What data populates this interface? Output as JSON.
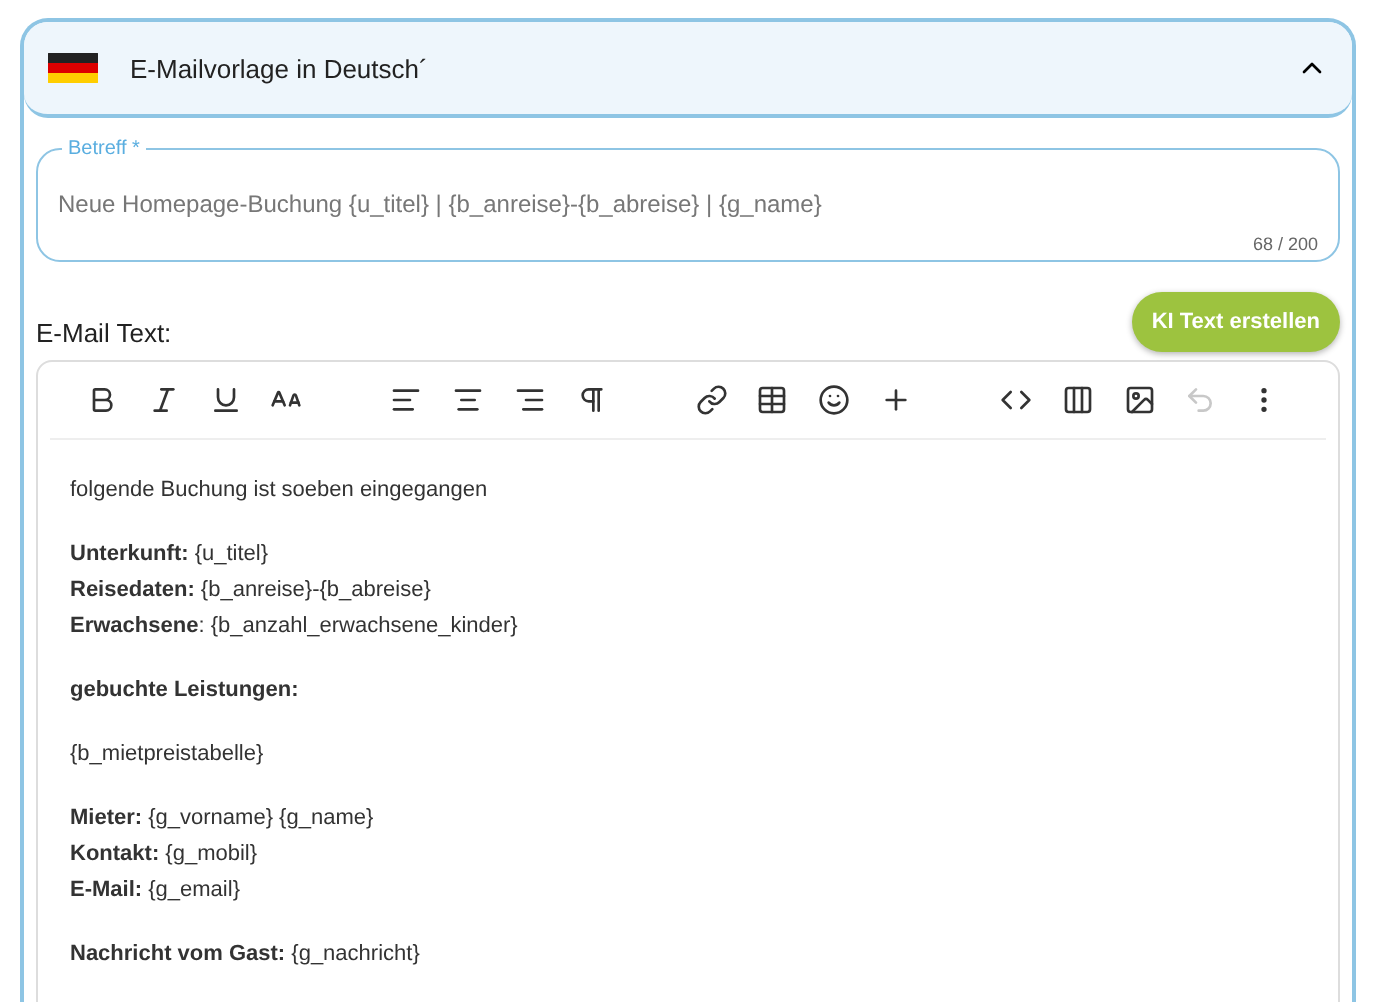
{
  "panel": {
    "title": "E-Mailvorlage in Deutsch´",
    "expanded": true
  },
  "subject": {
    "label": "Betreff *",
    "value": "Neue Homepage-Buchung {u_titel} | {b_anreise}-{b_abreise} | {g_name}",
    "counter": "68 / 200"
  },
  "email_text_label": "E-Mail Text:",
  "ai_button": "KI Text erstellen",
  "editor": {
    "undo_disabled": true,
    "paragraphs": [
      {
        "lines": [
          "folgende Buchung ist soeben eingegangen"
        ]
      },
      {
        "lines": [
          "**Unterkunft:** {u_titel}",
          "**Reisedaten:** {b_anreise}-{b_abreise}",
          "**Erwachsene**: {b_anzahl_erwachsene_kinder}"
        ]
      },
      {
        "lines": [
          "**gebuchte Leistungen:**"
        ]
      },
      {
        "lines": [
          "{b_mietpreistabelle}"
        ]
      },
      {
        "lines": [
          "**Mieter:** {g_vorname} {g_name}",
          "**Kontakt:** {g_mobil}",
          "**E-Mail:** {g_email}"
        ]
      },
      {
        "lines": [
          "**Nachricht vom Gast:** {g_nachricht}"
        ]
      }
    ]
  }
}
